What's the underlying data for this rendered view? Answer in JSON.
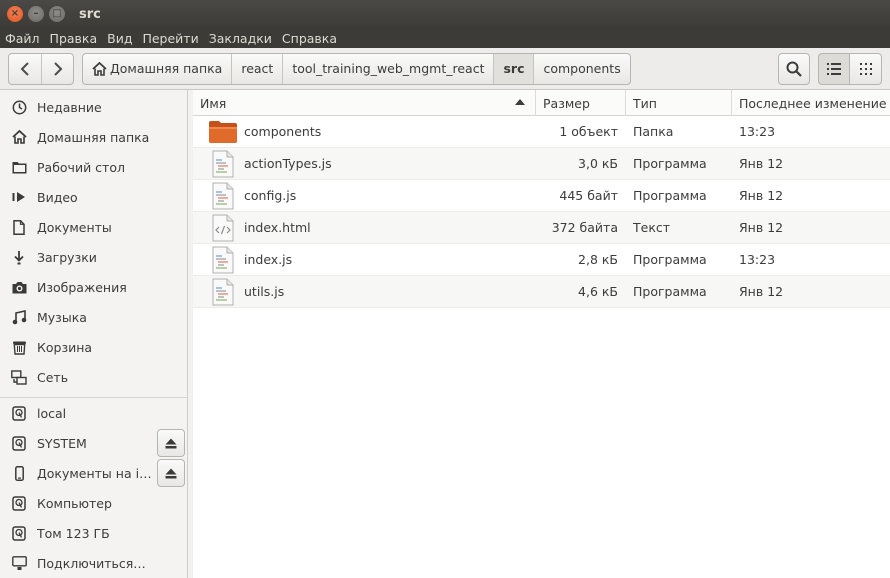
{
  "window": {
    "title": "src"
  },
  "menu": [
    "Файл",
    "Правка",
    "Вид",
    "Перейти",
    "Закладки",
    "Справка"
  ],
  "breadcrumbs": [
    {
      "label": "Домашняя папка",
      "home": true
    },
    {
      "label": "react"
    },
    {
      "label": "tool_training_web_mgmt_react"
    },
    {
      "label": "src",
      "active": true
    },
    {
      "label": "components"
    }
  ],
  "sidebar": {
    "places": [
      {
        "label": "Недавние",
        "icon": "clock-icon"
      },
      {
        "label": "Домашняя папка",
        "icon": "home-icon"
      },
      {
        "label": "Рабочий стол",
        "icon": "desktop-folder-icon"
      },
      {
        "label": "Видео",
        "icon": "video-icon"
      },
      {
        "label": "Документы",
        "icon": "document-icon"
      },
      {
        "label": "Загрузки",
        "icon": "download-icon"
      },
      {
        "label": "Изображения",
        "icon": "camera-icon"
      },
      {
        "label": "Музыка",
        "icon": "music-icon"
      },
      {
        "label": "Корзина",
        "icon": "trash-icon"
      },
      {
        "label": "Сеть",
        "icon": "network-icon"
      }
    ],
    "devices": [
      {
        "label": "local",
        "icon": "drive-icon",
        "eject": false
      },
      {
        "label": "SYSTEM",
        "icon": "drive-icon",
        "eject": true
      },
      {
        "label": "Документы на iPh…",
        "icon": "phone-icon",
        "eject": true
      },
      {
        "label": "Компьютер",
        "icon": "drive-icon",
        "eject": false
      },
      {
        "label": "Том 123 ГБ",
        "icon": "drive-icon",
        "eject": false
      },
      {
        "label": "Подключиться…",
        "icon": "connect-icon",
        "eject": false
      }
    ]
  },
  "columns": {
    "name": "Имя",
    "size": "Размер",
    "type": "Тип",
    "modified": "Последнее изменение"
  },
  "files": [
    {
      "name": "components",
      "size": "1 объект",
      "type": "Папка",
      "modified": "13:23",
      "icon": "folder-icon"
    },
    {
      "name": "actionTypes.js",
      "size": "3,0 кБ",
      "type": "Программа",
      "modified": "Янв 12",
      "icon": "script-icon"
    },
    {
      "name": "config.js",
      "size": "445 байт",
      "type": "Программа",
      "modified": "Янв 12",
      "icon": "script-icon"
    },
    {
      "name": "index.html",
      "size": "372 байта",
      "type": "Текст",
      "modified": "Янв 12",
      "icon": "html-icon"
    },
    {
      "name": "index.js",
      "size": "2,8 кБ",
      "type": "Программа",
      "modified": "13:23",
      "icon": "script-icon"
    },
    {
      "name": "utils.js",
      "size": "4,6 кБ",
      "type": "Программа",
      "modified": "Янв 12",
      "icon": "script-icon"
    }
  ],
  "colors": {
    "titlebar": "#3c3b37",
    "close": "#e0531d",
    "folder": "#e06a2a"
  }
}
